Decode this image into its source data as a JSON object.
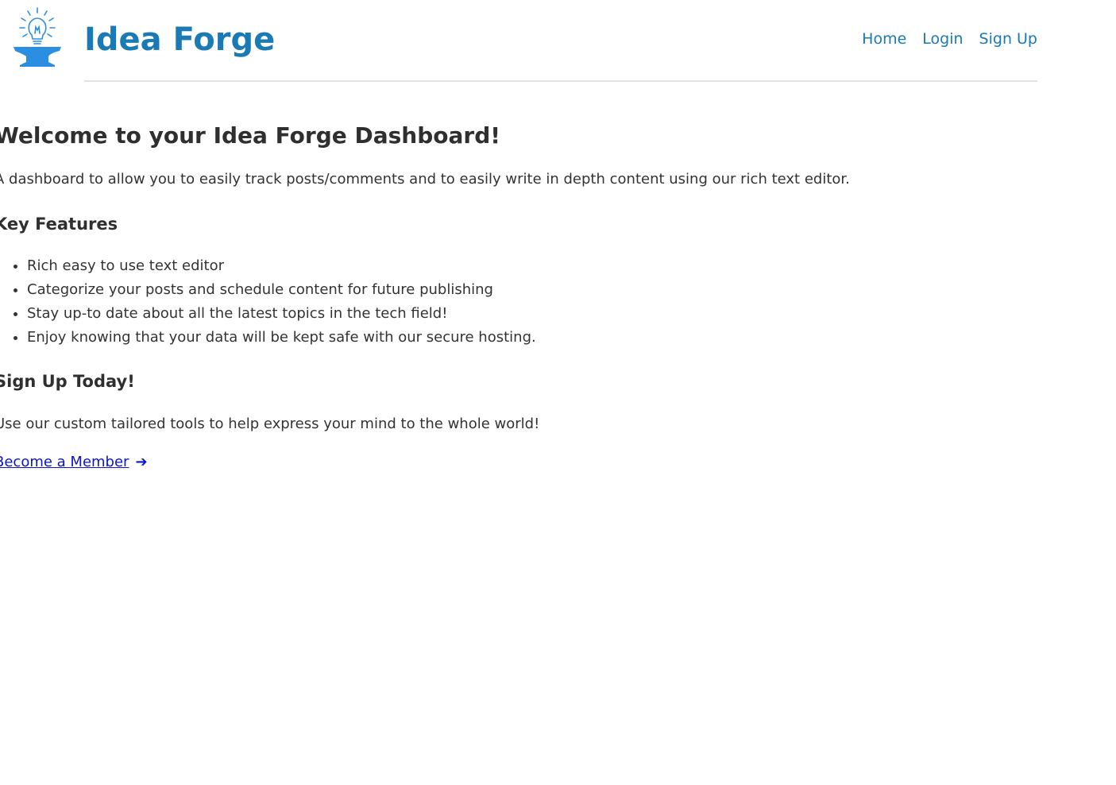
{
  "header": {
    "brand": "Idea Forge",
    "logo_icon": "lightbulb-anvil-icon",
    "brand_color": "#1a7ab5",
    "logo_color": "#2a8fe0",
    "nav": {
      "home": "Home",
      "login": "Login",
      "signup": "Sign Up"
    }
  },
  "main": {
    "title": "Welcome to your Idea Forge Dashboard!",
    "intro": "A dashboard to allow you to easily track posts/comments and to easily write in depth content using our rich text editor.",
    "features_heading": "Key Features",
    "features": [
      "Rich easy to use text editor",
      "Categorize your posts and schedule content for future publishing",
      "Stay up-to date about all the latest topics in the tech field!",
      "Enjoy knowing that your data will be kept safe with our secure hosting."
    ],
    "signup_heading": "Sign Up Today!",
    "signup_text": "Use our custom tailored tools to help express your mind to the whole world!",
    "member_link": "Become a Member",
    "member_link_icon": "arrow-right-icon",
    "link_color": "#0a15cc"
  }
}
